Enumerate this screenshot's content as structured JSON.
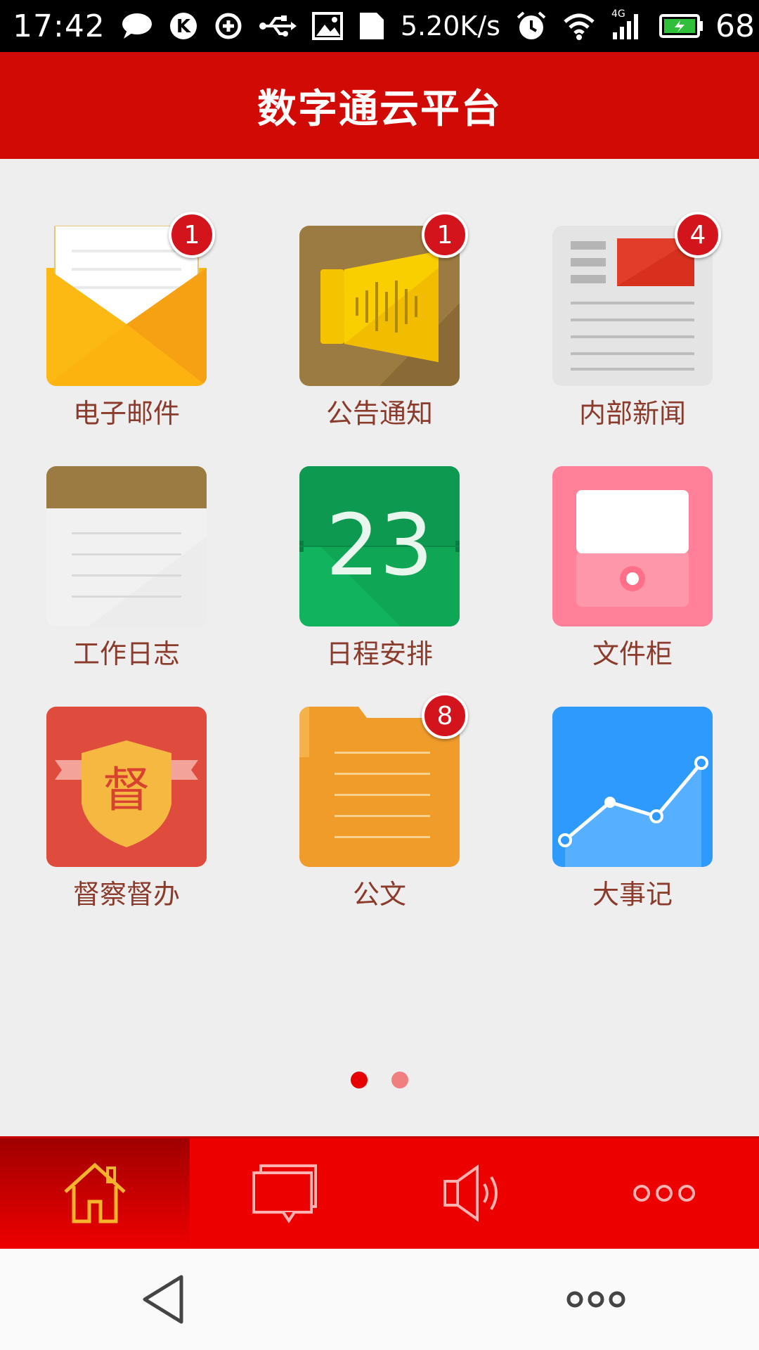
{
  "status_bar": {
    "time": "17:42",
    "network_speed": "5.20K/s",
    "network_type": "4G",
    "battery": "68",
    "icons": [
      "chat-icon",
      "k-icon",
      "sync-icon",
      "usb-icon",
      "image-icon",
      "sim-icon",
      "alarm-icon",
      "wifi-icon",
      "signal-icon",
      "battery-icon"
    ]
  },
  "header": {
    "title": "数字通云平台"
  },
  "grid": {
    "items": [
      {
        "label": "电子邮件",
        "badge": "1",
        "icon": "mail-icon"
      },
      {
        "label": "公告通知",
        "badge": "1",
        "icon": "announcement-icon"
      },
      {
        "label": "内部新闻",
        "badge": "4",
        "icon": "news-icon"
      },
      {
        "label": "工作日志",
        "badge": "",
        "icon": "notepad-icon"
      },
      {
        "label": "日程安排",
        "badge": "",
        "icon": "calendar-icon",
        "day": "23"
      },
      {
        "label": "文件柜",
        "badge": "",
        "icon": "cabinet-icon"
      },
      {
        "label": "督察督办",
        "badge": "",
        "icon": "supervision-icon",
        "glyph": "督"
      },
      {
        "label": "公文",
        "badge": "8",
        "icon": "document-folder-icon"
      },
      {
        "label": "大事记",
        "badge": "",
        "icon": "chart-icon"
      }
    ]
  },
  "pager": {
    "pages": 2,
    "current": 1
  },
  "tabs": [
    {
      "name": "home",
      "icon": "home-icon",
      "active": true
    },
    {
      "name": "messages",
      "icon": "chat-bubble-icon",
      "active": false
    },
    {
      "name": "announcements",
      "icon": "speaker-icon",
      "active": false
    },
    {
      "name": "more",
      "icon": "more-icon",
      "active": false
    }
  ],
  "colors": {
    "header_red": "#d20a05",
    "tab_red": "#ec0000",
    "label_brown": "#8a3b2c",
    "badge_red": "#d4141c"
  }
}
